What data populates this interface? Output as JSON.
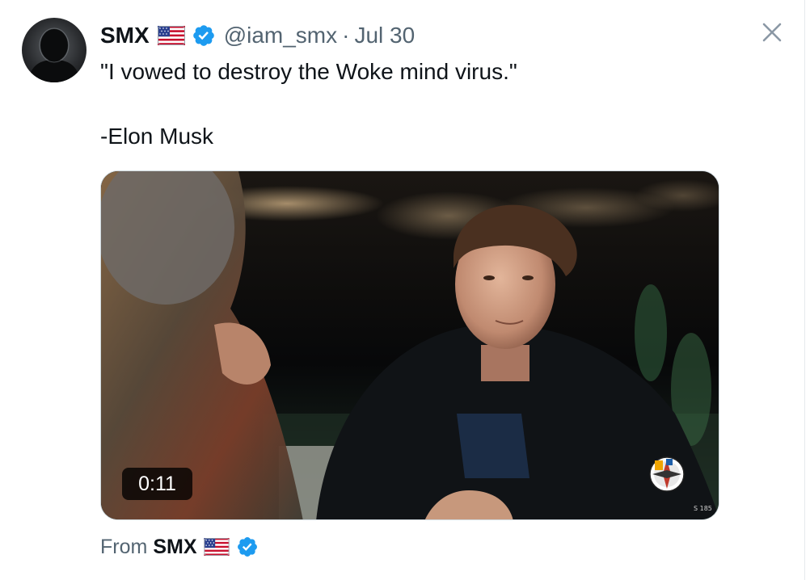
{
  "tweet": {
    "display_name": "SMX",
    "flag_icon": "us-flag-icon",
    "verified_icon": "verified-badge-icon",
    "handle": "@iam_smx",
    "separator": "·",
    "date": "Jul 30",
    "text_line1": "\"I vowed to destroy the Woke mind virus.\"",
    "text_line2": "-Elon Musk"
  },
  "media": {
    "type": "video",
    "duration": "0:11",
    "corner_tag": "S 185"
  },
  "footer": {
    "from_label": "From",
    "from_name": "SMX"
  },
  "controls": {
    "close_icon": "close-icon"
  },
  "colors": {
    "text_primary": "#0f1419",
    "text_secondary": "#536471",
    "verified_blue": "#1d9bf0",
    "close_gray": "#8b98a5"
  }
}
